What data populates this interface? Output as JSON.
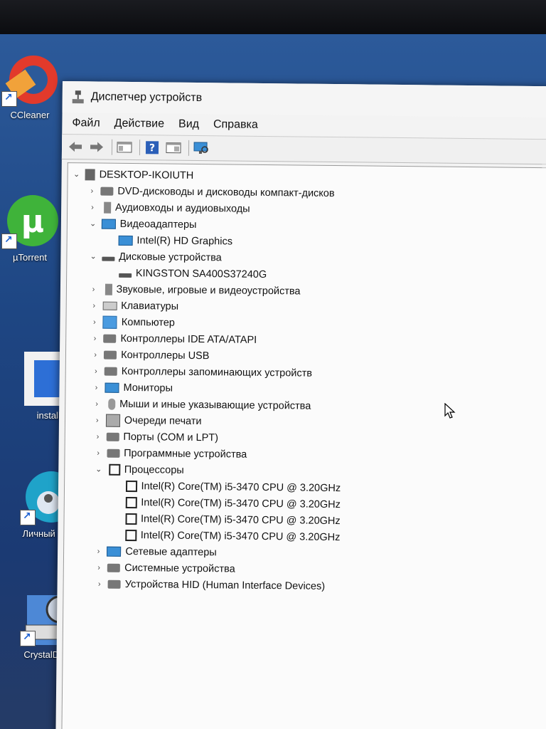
{
  "desktop": {
    "icons": [
      {
        "label": "CCleaner"
      },
      {
        "label": "µTorrent"
      },
      {
        "label": "installer"
      },
      {
        "label": "Личный - Ec"
      },
      {
        "label": "CrystalDiskI"
      }
    ]
  },
  "window": {
    "title": "Диспетчер устройств",
    "menu": [
      "Файл",
      "Действие",
      "Вид",
      "Справка"
    ]
  },
  "tree": {
    "root": "DESKTOP-IKOIUTH",
    "categories": [
      {
        "label": "DVD-дисководы и дисководы компакт-дисков",
        "expanded": false,
        "icon": "dvd-icon"
      },
      {
        "label": "Аудиовходы и аудиовыходы",
        "expanded": false,
        "icon": "speaker-icon"
      },
      {
        "label": "Видеоадаптеры",
        "expanded": true,
        "icon": "monitor-icon",
        "children": [
          "Intel(R) HD Graphics"
        ]
      },
      {
        "label": "Дисковые устройства",
        "expanded": true,
        "icon": "disk-icon",
        "children": [
          "KINGSTON SA400S37240G"
        ]
      },
      {
        "label": "Звуковые, игровые и видеоустройства",
        "expanded": false,
        "icon": "speaker-icon"
      },
      {
        "label": "Клавиатуры",
        "expanded": false,
        "icon": "keyboard-icon"
      },
      {
        "label": "Компьютер",
        "expanded": false,
        "icon": "computer-icon"
      },
      {
        "label": "Контроллеры IDE ATA/ATAPI",
        "expanded": false,
        "icon": "controller-icon"
      },
      {
        "label": "Контроллеры USB",
        "expanded": false,
        "icon": "usb-icon"
      },
      {
        "label": "Контроллеры запоминающих устройств",
        "expanded": false,
        "icon": "storage-icon"
      },
      {
        "label": "Мониторы",
        "expanded": false,
        "icon": "monitor-icon"
      },
      {
        "label": "Мыши и иные указывающие устройства",
        "expanded": false,
        "icon": "mouse-icon"
      },
      {
        "label": "Очереди печати",
        "expanded": false,
        "icon": "printer-icon"
      },
      {
        "label": "Порты (COM и LPT)",
        "expanded": false,
        "icon": "port-icon"
      },
      {
        "label": "Программные устройства",
        "expanded": false,
        "icon": "software-icon"
      },
      {
        "label": "Процессоры",
        "expanded": true,
        "icon": "cpu-icon",
        "children": [
          "Intel(R) Core(TM) i5-3470 CPU @ 3.20GHz",
          "Intel(R) Core(TM) i5-3470 CPU @ 3.20GHz",
          "Intel(R) Core(TM) i5-3470 CPU @ 3.20GHz",
          "Intel(R) Core(TM) i5-3470 CPU @ 3.20GHz"
        ]
      },
      {
        "label": "Сетевые адаптеры",
        "expanded": false,
        "icon": "network-icon"
      },
      {
        "label": "Системные устройства",
        "expanded": false,
        "icon": "system-icon"
      },
      {
        "label": "Устройства HID (Human Interface Devices)",
        "expanded": false,
        "icon": "hid-icon"
      }
    ]
  }
}
